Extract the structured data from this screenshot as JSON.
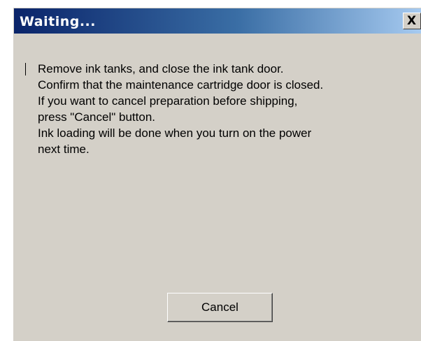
{
  "window": {
    "title": "Waiting...",
    "close_glyph": "X"
  },
  "message": {
    "lines": [
      "Remove ink tanks, and close the ink tank door.",
      "Confirm that the maintenance cartridge door is closed.",
      "If you want to cancel preparation before shipping,",
      "press \"Cancel\" button.",
      "Ink loading will be done when you turn on the power",
      "next time."
    ]
  },
  "buttons": {
    "cancel_label": "Cancel"
  },
  "icons": {
    "close": "close-icon"
  },
  "colors": {
    "titlebar_start": "#0a246a",
    "titlebar_end": "#a6caf0",
    "window_background": "#d4d0c8"
  }
}
